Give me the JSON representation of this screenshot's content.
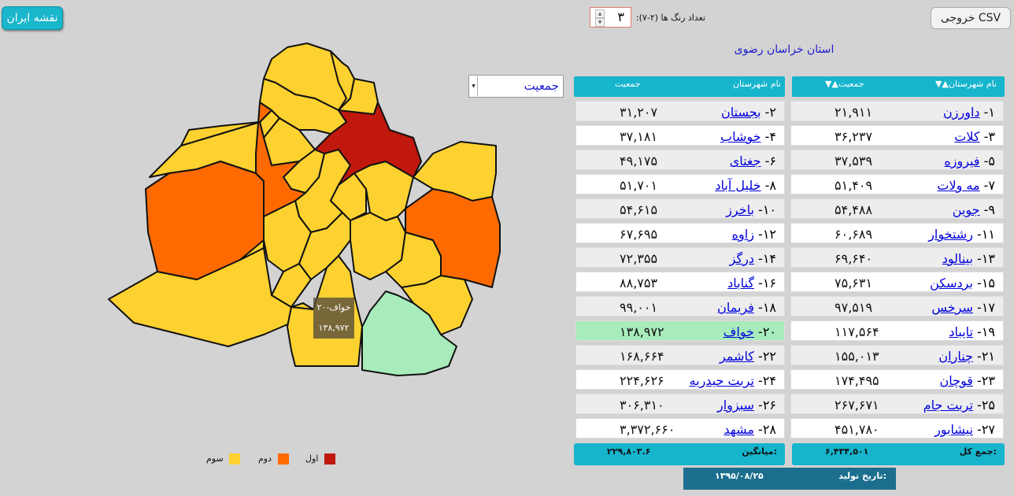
{
  "header": {
    "iran_button": "نقشه ایران",
    "csv_button": "خروجی CSV",
    "color_count_label": "تعداد رنگ ها (۲-۷):",
    "color_count_value": "۳"
  },
  "province_title": "استان خراسان رضوی",
  "metric_select": {
    "selected": "جمعیت"
  },
  "tooltip": {
    "name": "۲۰-خواف",
    "value": "۱۳۸,۹۷۲"
  },
  "legend": [
    {
      "label": "اول",
      "color": "#c0180c"
    },
    {
      "label": "دوم",
      "color": "#fe6a00"
    },
    {
      "label": "سوم",
      "color": "#fdd12f"
    }
  ],
  "colors": {
    "first": "#c0180c",
    "second": "#fe6a00",
    "third": "#fdd12f",
    "selected": "#a8ecbb",
    "header": "#16b4cd"
  },
  "table": {
    "right_header": {
      "name": "▼▲نام شهرستان",
      "pop": "▼▲جمعیت"
    },
    "left_header": {
      "name": "نام شهرستان",
      "pop": "جمعیت"
    },
    "rows": [
      {
        "r_no": "۱-",
        "r_name": "داورزن",
        "r_pop": "۲۱,۹۱۱",
        "l_no": "۲-",
        "l_name": "بجستان",
        "l_pop": "۳۱,۲۰۷"
      },
      {
        "r_no": "۳-",
        "r_name": "کلات",
        "r_pop": "۳۶,۲۳۷",
        "l_no": "۴-",
        "l_name": "خوشاب",
        "l_pop": "۳۷,۱۸۱"
      },
      {
        "r_no": "۵-",
        "r_name": "فیروزه",
        "r_pop": "۳۷,۵۳۹",
        "l_no": "۶-",
        "l_name": "جغتای",
        "l_pop": "۴۹,۱۷۵"
      },
      {
        "r_no": "۷-",
        "r_name": "مه ولات",
        "r_pop": "۵۱,۴۰۹",
        "l_no": "۸-",
        "l_name": "خلیل آباد",
        "l_pop": "۵۱,۷۰۱"
      },
      {
        "r_no": "۹-",
        "r_name": "جوین",
        "r_pop": "۵۴,۴۸۸",
        "l_no": "۱۰-",
        "l_name": "باخرز",
        "l_pop": "۵۴,۶۱۵"
      },
      {
        "r_no": "۱۱-",
        "r_name": "رشتخوار",
        "r_pop": "۶۰,۶۸۹",
        "l_no": "۱۲-",
        "l_name": "زاوه",
        "l_pop": "۶۷,۶۹۵"
      },
      {
        "r_no": "۱۳-",
        "r_name": "بینالود",
        "r_pop": "۶۹,۶۴۰",
        "l_no": "۱۴-",
        "l_name": "درگز",
        "l_pop": "۷۲,۳۵۵"
      },
      {
        "r_no": "۱۵-",
        "r_name": "بردسکن",
        "r_pop": "۷۵,۶۳۱",
        "l_no": "۱۶-",
        "l_name": "گناباد",
        "l_pop": "۸۸,۷۵۳"
      },
      {
        "r_no": "۱۷-",
        "r_name": "سرخس",
        "r_pop": "۹۷,۵۱۹",
        "l_no": "۱۸-",
        "l_name": "فریمان",
        "l_pop": "۹۹,۰۰۱"
      },
      {
        "r_no": "۱۹-",
        "r_name": "تایباد",
        "r_pop": "۱۱۷,۵۶۴",
        "l_no": "۲۰-",
        "l_name": "خواف",
        "l_pop": "۱۳۸,۹۷۲",
        "l_selected": true
      },
      {
        "r_no": "۲۱-",
        "r_name": "چناران",
        "r_pop": "۱۵۵,۰۱۳",
        "l_no": "۲۲-",
        "l_name": "کاشمر",
        "l_pop": "۱۶۸,۶۶۴"
      },
      {
        "r_no": "۲۳-",
        "r_name": "قوچان",
        "r_pop": "۱۷۴,۴۹۵",
        "l_no": "۲۴-",
        "l_name": "تربت حیدریه",
        "l_pop": "۲۲۴,۶۲۶"
      },
      {
        "r_no": "۲۵-",
        "r_name": "تربت جام",
        "r_pop": "۲۶۷,۶۷۱",
        "l_no": "۲۶-",
        "l_name": "سبزوار",
        "l_pop": "۳۰۶,۳۱۰"
      },
      {
        "r_no": "۲۷-",
        "r_name": "نیشابور",
        "r_pop": "۴۵۱,۷۸۰",
        "l_no": "۲۸-",
        "l_name": "مشهد",
        "l_pop": "۳,۳۷۲,۶۶۰"
      }
    ],
    "total": {
      "label": "جمع کل:",
      "value": "۶,۴۳۴,۵۰۱"
    },
    "average": {
      "label": "میانگین:",
      "value": "۲۲۹,۸۰۳.۶"
    }
  },
  "production_date": {
    "label": "تاریخ تولید:",
    "value": "۱۳۹۵/۰۸/۲۵"
  }
}
